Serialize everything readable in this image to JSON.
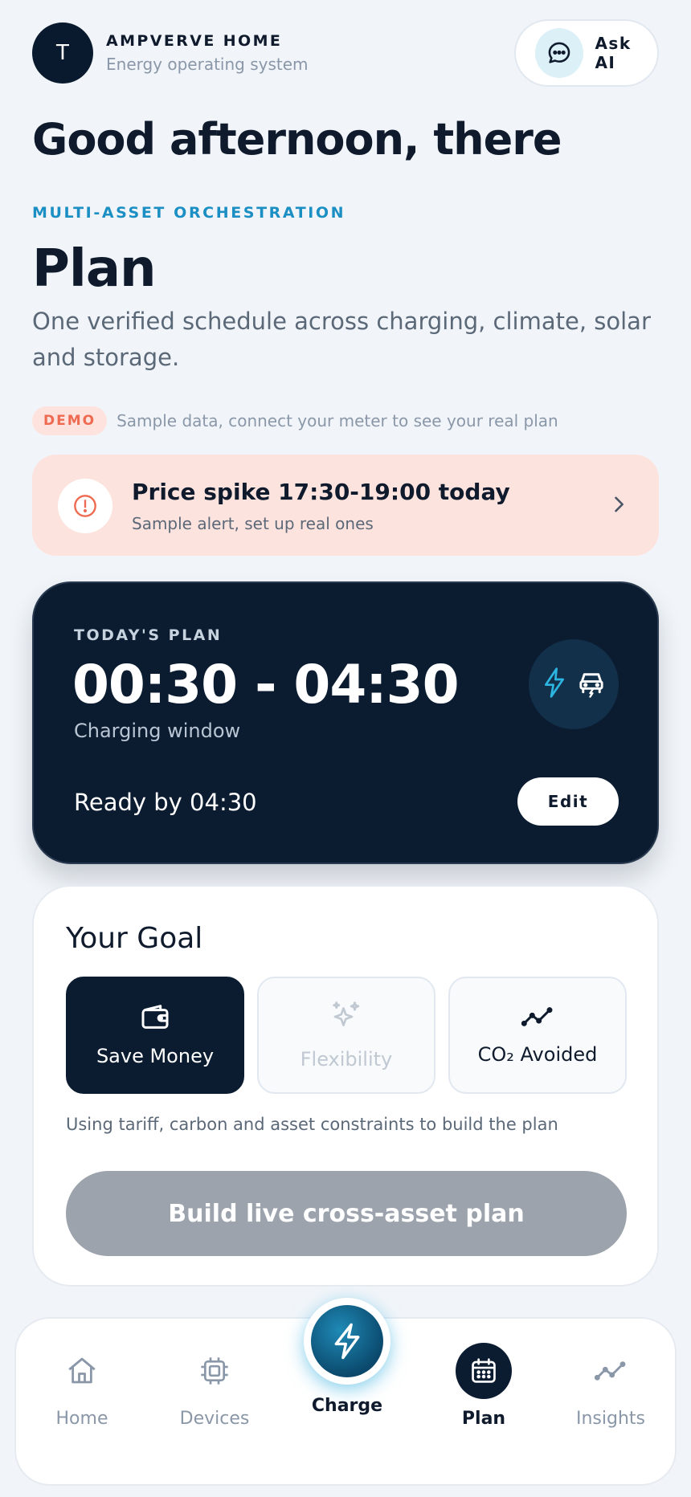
{
  "header": {
    "avatar_initial": "T",
    "brand_name": "AMPVERVE HOME",
    "brand_sub": "Energy operating system",
    "ask_ai_label": "Ask AI"
  },
  "greeting": "Good afternoon, there",
  "eyebrow": "MULTI-ASSET ORCHESTRATION",
  "page_title": "Plan",
  "page_description": "One verified schedule across charging, climate, solar and storage.",
  "demo": {
    "badge": "DEMO",
    "text": "Sample data, connect your meter to see your real plan"
  },
  "alert": {
    "title": "Price spike 17:30-19:00 today",
    "subtitle": "Sample alert, set up real ones"
  },
  "todays_plan": {
    "eyebrow": "TODAY'S PLAN",
    "time_window": "00:30 - 04:30",
    "window_label": "Charging window",
    "ready_text": "Ready by 04:30",
    "edit_label": "Edit"
  },
  "goal": {
    "title": "Your Goal",
    "options": [
      {
        "label": "Save Money",
        "icon": "wallet-icon",
        "state": "selected"
      },
      {
        "label": "Flexibility",
        "icon": "sparkles-icon",
        "state": "disabled"
      },
      {
        "label": "CO₂ Avoided",
        "icon": "trend-icon",
        "state": "default"
      }
    ],
    "note": "Using tariff, carbon and asset constraints to build the plan",
    "build_label": "Build live cross-asset plan"
  },
  "nav": {
    "home": "Home",
    "devices": "Devices",
    "charge": "Charge",
    "plan": "Plan",
    "insights": "Insights",
    "active": "plan"
  },
  "colors": {
    "accent": "#1b8fc4",
    "dark": "#0b1c31",
    "alert_bg": "#fde3de",
    "alert_accent": "#ee6a50",
    "disabled_button": "#9ca3ac"
  }
}
